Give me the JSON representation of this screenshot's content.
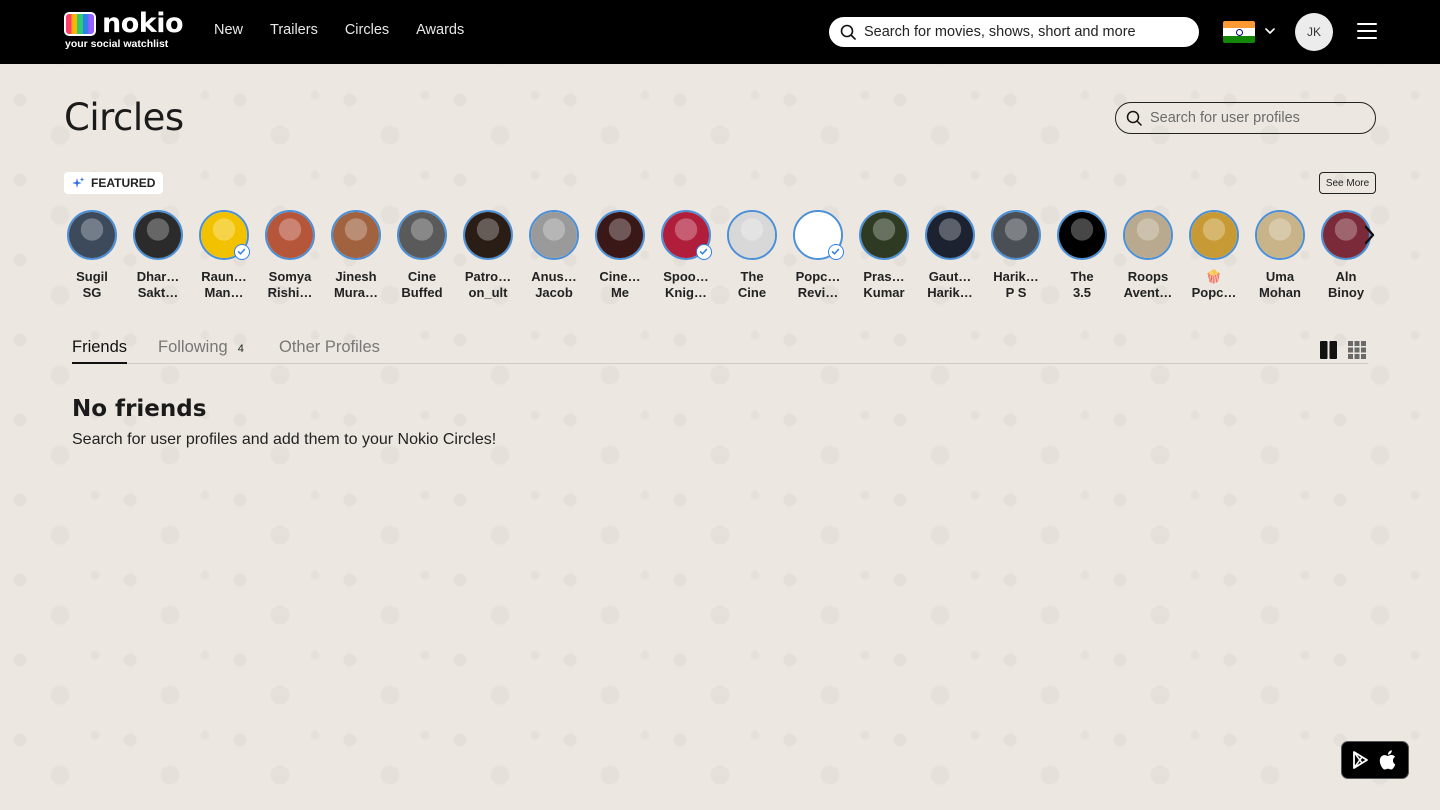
{
  "brand": {
    "name": "nokio",
    "tagline": "your social watchlist"
  },
  "nav": {
    "links": [
      "New",
      "Trailers",
      "Circles",
      "Awards"
    ]
  },
  "top_search": {
    "placeholder": "Search for movies, shows, short and more"
  },
  "user": {
    "initials": "JK",
    "country_flag": "india-flag-icon"
  },
  "page": {
    "title": "Circles",
    "profile_search_placeholder": "Search for user profiles"
  },
  "featured": {
    "label": "FEATURED",
    "see_more": "See More",
    "profiles": [
      {
        "line1": "Sugil",
        "line2": "SG",
        "color": "#3d4a5c",
        "verified": false
      },
      {
        "line1": "Dhar…",
        "line2": "Sakt…",
        "color": "#2b2b2b",
        "verified": false
      },
      {
        "line1": "Raun…",
        "line2": "Man…",
        "color": "#f2c200",
        "verified": true
      },
      {
        "line1": "Somya",
        "line2": "Rishi…",
        "color": "#b5553a",
        "verified": false
      },
      {
        "line1": "Jinesh",
        "line2": "Mura…",
        "color": "#a0623f",
        "verified": false
      },
      {
        "line1": "Cine",
        "line2": "Buffed",
        "color": "#5a5a5a",
        "verified": false
      },
      {
        "line1": "Patro…",
        "line2": "on_ult",
        "color": "#2a1d16",
        "verified": false
      },
      {
        "line1": "Anus…",
        "line2": "Jacob",
        "color": "#9a9a9a",
        "verified": false
      },
      {
        "line1": "Cine…",
        "line2": "Me",
        "color": "#3a1818",
        "verified": false
      },
      {
        "line1": "Spoo…",
        "line2": "Knig…",
        "color": "#b01e3c",
        "verified": true
      },
      {
        "line1": "The",
        "line2": "Cine",
        "color": "#d8d8d8",
        "verified": false
      },
      {
        "line1": "Popc…",
        "line2": "Revi…",
        "color": "#ffffff",
        "verified": true
      },
      {
        "line1": "Pras…",
        "line2": "Kumar",
        "color": "#2e3a22",
        "verified": false
      },
      {
        "line1": "Gaut…",
        "line2": "Harik…",
        "color": "#1c2230",
        "verified": false
      },
      {
        "line1": "Harik…",
        "line2": "P S",
        "color": "#4a4f55",
        "verified": false
      },
      {
        "line1": "The",
        "line2": "3.5",
        "color": "#000000",
        "verified": false
      },
      {
        "line1": "Roops",
        "line2": "Avent…",
        "color": "#b9a98e",
        "verified": false
      },
      {
        "line1": "🍿",
        "line2": "Popc…",
        "color": "#c89a36",
        "verified": false
      },
      {
        "line1": "Uma",
        "line2": "Mohan",
        "color": "#c9b48a",
        "verified": false
      },
      {
        "line1": "Aln",
        "line2": "Binoy",
        "color": "#7a2a38",
        "verified": false
      }
    ]
  },
  "tabs": [
    {
      "label": "Friends",
      "count": ""
    },
    {
      "label": "Following",
      "count": "4"
    },
    {
      "label": "Other Profiles",
      "count": ""
    }
  ],
  "empty_state": {
    "title": "No friends",
    "description": "Search for user profiles and add them to your Nokio Circles!"
  },
  "app_badge": {
    "icons": [
      "google-play-icon",
      "apple-icon"
    ]
  }
}
